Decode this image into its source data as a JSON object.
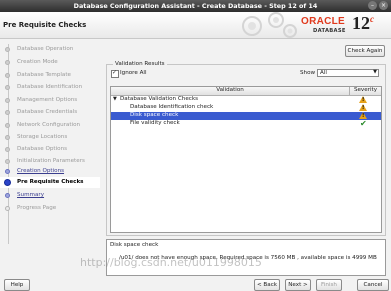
{
  "window": {
    "title": "Database Configuration Assistant - Create Database - Step 12 of 14"
  },
  "header": {
    "page_title": "Pre Requisite Checks",
    "brand": "ORACLE",
    "product": "DATABASE",
    "version": "12",
    "version_suffix": "c"
  },
  "steps": [
    {
      "label": "Database Operation",
      "state": "done"
    },
    {
      "label": "Creation Mode",
      "state": "done"
    },
    {
      "label": "Database Template",
      "state": "done"
    },
    {
      "label": "Database Identification",
      "state": "done"
    },
    {
      "label": "Management Options",
      "state": "done"
    },
    {
      "label": "Database Credentials",
      "state": "done"
    },
    {
      "label": "Network Configuration",
      "state": "done"
    },
    {
      "label": "Storage Locations",
      "state": "done"
    },
    {
      "label": "Database Options",
      "state": "done"
    },
    {
      "label": "Initialization Parameters",
      "state": "done"
    },
    {
      "label": "Creation Options",
      "state": "link"
    },
    {
      "label": "Pre Requisite Checks",
      "state": "current"
    },
    {
      "label": "Summary",
      "state": "link"
    },
    {
      "label": "Progress Page",
      "state": "pending"
    }
  ],
  "main": {
    "check_again": "Check Again",
    "group_title": "Validation Results",
    "ignore_all": "Ignore All",
    "show_label": "Show",
    "show_value": "All",
    "columns": [
      "Validation",
      "Severity"
    ],
    "rows": [
      {
        "text": "Database Validation Checks",
        "severity": "warning",
        "level": 0
      },
      {
        "text": "Database Identification check",
        "severity": "warning",
        "level": 1
      },
      {
        "text": "Disk space check",
        "severity": "warning",
        "level": 1
      },
      {
        "text": "File validity check",
        "severity": "ok",
        "level": 1
      }
    ],
    "details_title": "Disk space check",
    "details_message": "/u01/ does not have enough space. Required space is 7560 MB , available space is 4999 MB"
  },
  "watermark": "http://blog.csdn.net/u011998015",
  "buttons": {
    "help": "Help",
    "back": "< Back",
    "next": "Next >",
    "finish": "Finish",
    "cancel": "Cancel"
  },
  "colors": {
    "accent": "#3a5bd0",
    "oracle_red": "#e03a1e",
    "warning": "#e6a21a",
    "ok": "#2a8a2a"
  }
}
